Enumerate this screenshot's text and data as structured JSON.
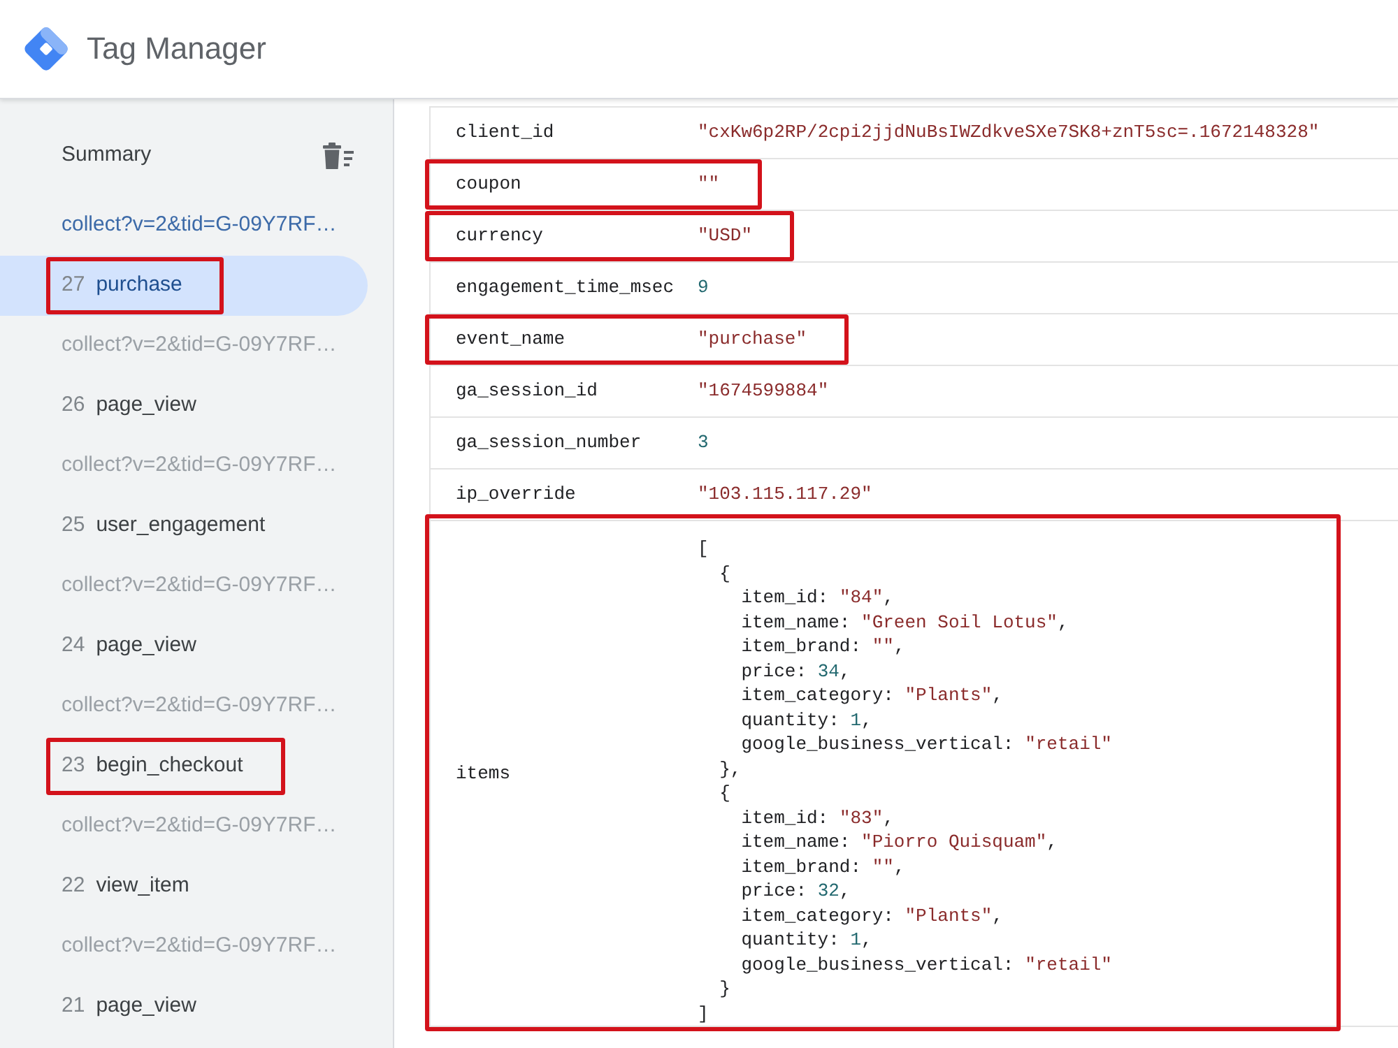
{
  "header": {
    "title": "Tag Manager"
  },
  "sidebar": {
    "summary": "Summary",
    "items": [
      {
        "kind": "request",
        "label": "collect?v=2&tid=G-09Y7RF…",
        "active": true,
        "selected": false,
        "highlighted": false
      },
      {
        "kind": "event",
        "number": "27",
        "name": "purchase",
        "selected": true,
        "highlighted": true
      },
      {
        "kind": "request",
        "label": "collect?v=2&tid=G-09Y7RF…",
        "active": false,
        "selected": false,
        "highlighted": false
      },
      {
        "kind": "event",
        "number": "26",
        "name": "page_view",
        "selected": false,
        "highlighted": false
      },
      {
        "kind": "request",
        "label": "collect?v=2&tid=G-09Y7RF…",
        "active": false,
        "selected": false,
        "highlighted": false
      },
      {
        "kind": "event",
        "number": "25",
        "name": "user_engagement",
        "selected": false,
        "highlighted": false
      },
      {
        "kind": "request",
        "label": "collect?v=2&tid=G-09Y7RF…",
        "active": false,
        "selected": false,
        "highlighted": false
      },
      {
        "kind": "event",
        "number": "24",
        "name": "page_view",
        "selected": false,
        "highlighted": false
      },
      {
        "kind": "request",
        "label": "collect?v=2&tid=G-09Y7RF…",
        "active": false,
        "selected": false,
        "highlighted": false
      },
      {
        "kind": "event",
        "number": "23",
        "name": "begin_checkout",
        "selected": false,
        "highlighted": true
      },
      {
        "kind": "request",
        "label": "collect?v=2&tid=G-09Y7RF…",
        "active": false,
        "selected": false,
        "highlighted": false
      },
      {
        "kind": "event",
        "number": "22",
        "name": "view_item",
        "selected": false,
        "highlighted": false
      },
      {
        "kind": "request",
        "label": "collect?v=2&tid=G-09Y7RF…",
        "active": false,
        "selected": false,
        "highlighted": false
      },
      {
        "kind": "event",
        "number": "21",
        "name": "page_view",
        "selected": false,
        "highlighted": false
      }
    ]
  },
  "parameters": [
    {
      "key": "client_id",
      "kind": "string",
      "value": "\"cxKw6p2RP/2cpi2jjdNuBsIWZdkveSXe7SK8+znT5sc=.1672148328\"",
      "highlighted": false
    },
    {
      "key": "coupon",
      "kind": "string",
      "value": "\"\"",
      "highlighted": true
    },
    {
      "key": "currency",
      "kind": "string",
      "value": "\"USD\"",
      "highlighted": true
    },
    {
      "key": "engagement_time_msec",
      "kind": "number",
      "value": "9",
      "highlighted": false
    },
    {
      "key": "event_name",
      "kind": "string",
      "value": "\"purchase\"",
      "highlighted": true
    },
    {
      "key": "ga_session_id",
      "kind": "string",
      "value": "\"1674599884\"",
      "highlighted": false
    },
    {
      "key": "ga_session_number",
      "kind": "number",
      "value": "3",
      "highlighted": false
    },
    {
      "key": "ip_override",
      "kind": "string",
      "value": "\"103.115.117.29\"",
      "highlighted": false
    },
    {
      "key": "items",
      "kind": "array",
      "highlighted": true,
      "open": "[",
      "close": "]",
      "children": [
        {
          "open": "{",
          "close": "},",
          "children": [
            {
              "key": "item_id:",
              "value": "\"84\"",
              "kind": "string",
              "tail": ","
            },
            {
              "key": "item_name:",
              "value": "\"Green Soil Lotus\"",
              "kind": "string",
              "tail": ","
            },
            {
              "key": "item_brand:",
              "value": "\"\"",
              "kind": "string",
              "tail": ","
            },
            {
              "key": "price:",
              "value": "34",
              "kind": "number",
              "tail": ","
            },
            {
              "key": "item_category:",
              "value": "\"Plants\"",
              "kind": "string",
              "tail": ","
            },
            {
              "key": "quantity:",
              "value": "1",
              "kind": "number",
              "tail": ","
            },
            {
              "key": "google_business_vertical:",
              "value": "\"retail\"",
              "kind": "string"
            }
          ]
        },
        {
          "open": "{",
          "close": "}",
          "children": [
            {
              "key": "item_id:",
              "value": "\"83\"",
              "kind": "string",
              "tail": ","
            },
            {
              "key": "item_name:",
              "value": "\"Piorro Quisquam\"",
              "kind": "string",
              "tail": ","
            },
            {
              "key": "item_brand:",
              "value": "\"\"",
              "kind": "string",
              "tail": ","
            },
            {
              "key": "price:",
              "value": "32",
              "kind": "number",
              "tail": ","
            },
            {
              "key": "item_category:",
              "value": "\"Plants\"",
              "kind": "string",
              "tail": ","
            },
            {
              "key": "quantity:",
              "value": "1",
              "kind": "number",
              "tail": ","
            },
            {
              "key": "google_business_vertical:",
              "value": "\"retail\"",
              "kind": "string"
            }
          ]
        }
      ]
    }
  ]
}
